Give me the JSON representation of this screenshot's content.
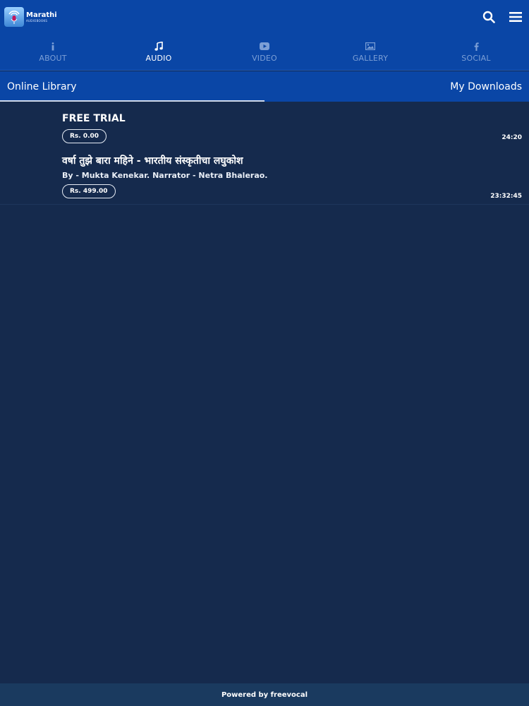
{
  "app": {
    "logo_line1": "Marathi",
    "logo_line2": "AUDIOBOOKS"
  },
  "nav_tabs": [
    {
      "label": "ABOUT",
      "icon": "info-icon"
    },
    {
      "label": "AUDIO",
      "icon": "music-note-icon",
      "active": true
    },
    {
      "label": "VIDEO",
      "icon": "youtube-play-icon"
    },
    {
      "label": "GALLERY",
      "icon": "image-icon"
    },
    {
      "label": "SOCIAL",
      "icon": "facebook-icon"
    }
  ],
  "sub_tabs": {
    "online_library": "Online Library",
    "my_downloads": "My Downloads"
  },
  "items": [
    {
      "title": "FREE TRIAL",
      "subtitle": "",
      "price": "Rs. 0.00",
      "duration": "24:20"
    },
    {
      "title": "वर्षा तुझे बारा महिने - भारतीय संस्कृतीचा लघुकोश",
      "subtitle": "By - Mukta Kenekar. Narrator - Netra Bhalerao.",
      "price": "Rs. 499.00",
      "duration": "23:32:45"
    }
  ],
  "footer": {
    "text": "Powered by freevocal"
  },
  "colors": {
    "header_bg": "#0a46a6",
    "page_bg": "#152a4d",
    "footer_bg": "#1a3a5f",
    "inactive_tab": "#7c9fd6",
    "active_tab": "#ffffff"
  }
}
